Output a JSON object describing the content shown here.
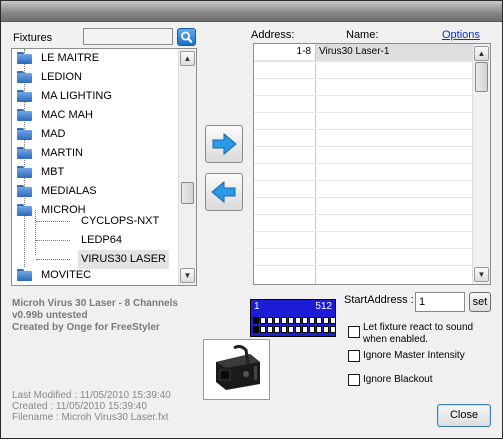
{
  "fixtures_label": "Fixtures",
  "search": {
    "value": "",
    "icon": "search-icon"
  },
  "tree": {
    "items": [
      {
        "label": "LE MAITRE",
        "type": "folder"
      },
      {
        "label": "LEDION",
        "type": "folder"
      },
      {
        "label": "MA LIGHTING",
        "type": "folder"
      },
      {
        "label": "MAC MAH",
        "type": "folder"
      },
      {
        "label": "MAD",
        "type": "folder"
      },
      {
        "label": "MARTIN",
        "type": "folder"
      },
      {
        "label": "MBT",
        "type": "folder"
      },
      {
        "label": "MEDIALAS",
        "type": "folder"
      },
      {
        "label": "MICROH",
        "type": "folder"
      },
      {
        "label": "CYCLOPS-NXT",
        "type": "fixture"
      },
      {
        "label": "LEDP64",
        "type": "fixture"
      },
      {
        "label": "VIRUS30 LASER",
        "type": "fixture",
        "selected": true
      },
      {
        "label": "MOVITEC",
        "type": "folder"
      }
    ]
  },
  "grid": {
    "address_header": "Address:",
    "name_header": "Name:",
    "options_link": "Options",
    "rows": [
      {
        "address": "1-8",
        "name": "Virus30 Laser-1"
      }
    ]
  },
  "buttons": {
    "add_icon": "arrow-right-icon",
    "remove_icon": "arrow-left-icon",
    "set": "set",
    "close": "Close"
  },
  "fixture_info": {
    "title": "Microh Virus 30 Laser - 8 Channels",
    "version": "v0.99b untested",
    "author": "Created by Onge for FreeStyler",
    "last_modified": "Last Modified : 11/05/2010 15:39:40",
    "created": "Created : 11/05/2010 15:39:40",
    "filename": "Filename : Microh Virus30 Laser.fxt"
  },
  "dmx_map": {
    "start": "1",
    "end": "512"
  },
  "start_address": {
    "label": "StartAddress :",
    "value": "1"
  },
  "checkboxes": {
    "sound": "Let fixture react to sound when enabled.",
    "master": "Ignore Master Intensity",
    "blackout": "Ignore Blackout"
  }
}
